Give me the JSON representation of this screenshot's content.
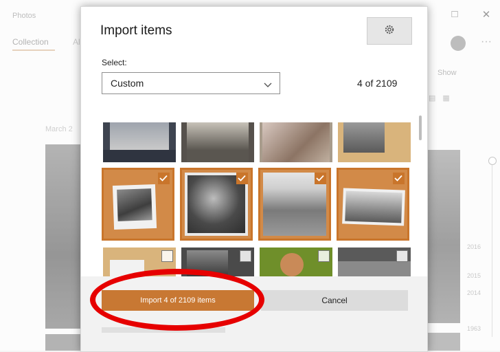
{
  "app": {
    "title": "Photos",
    "tab_collection": "Collection",
    "tab_other": "Al",
    "date_label": "March 2",
    "show_label": "Show",
    "years": [
      "2016",
      "2015",
      "2014",
      "1963"
    ]
  },
  "dialog": {
    "title": "Import items",
    "select_label": "Select:",
    "select_value": "Custom",
    "count": "4 of 2109",
    "import_button": "Import 4 of 2109 items",
    "cancel_button": "Cancel"
  },
  "colors": {
    "accent": "#c87833",
    "highlight_ring": "#e60000"
  },
  "thumbnails": [
    {
      "row": 1,
      "col": 1,
      "selected": false
    },
    {
      "row": 1,
      "col": 2,
      "selected": false
    },
    {
      "row": 1,
      "col": 3,
      "selected": false
    },
    {
      "row": 1,
      "col": 4,
      "selected": false
    },
    {
      "row": 2,
      "col": 1,
      "selected": true
    },
    {
      "row": 2,
      "col": 2,
      "selected": true
    },
    {
      "row": 2,
      "col": 3,
      "selected": true
    },
    {
      "row": 2,
      "col": 4,
      "selected": true
    },
    {
      "row": 3,
      "col": 1,
      "selected": false
    },
    {
      "row": 3,
      "col": 2,
      "selected": false
    },
    {
      "row": 3,
      "col": 3,
      "selected": false
    },
    {
      "row": 3,
      "col": 4,
      "selected": false
    }
  ]
}
